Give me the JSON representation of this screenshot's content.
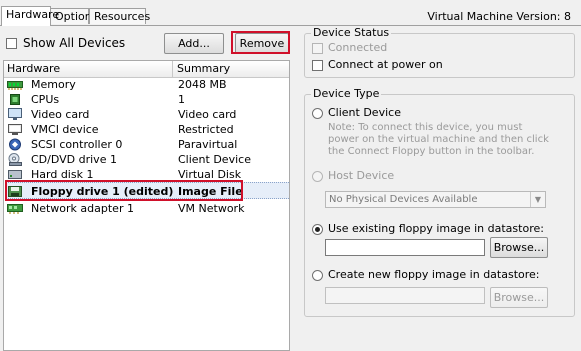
{
  "tabs": [
    {
      "label": "Hardware",
      "active": true
    },
    {
      "label": "Options",
      "active": false
    },
    {
      "label": "Resources",
      "active": false
    }
  ],
  "vm_version_label": "Virtual Machine Version: 8",
  "left": {
    "show_all_devices_label": "Show All Devices",
    "show_all_devices_checked": false,
    "add_button": "Add...",
    "remove_button": "Remove",
    "columns": [
      "Hardware",
      "Summary"
    ],
    "devices": [
      {
        "name": "Memory",
        "summary": "2048 MB",
        "icon": "memory-icon"
      },
      {
        "name": "CPUs",
        "summary": "1",
        "icon": "cpu-icon"
      },
      {
        "name": "Video card",
        "summary": "Video card",
        "icon": "monitor-icon"
      },
      {
        "name": "VMCI device",
        "summary": "Restricted",
        "icon": "vmci-icon"
      },
      {
        "name": "SCSI controller 0",
        "summary": "Paravirtual",
        "icon": "scsi-icon"
      },
      {
        "name": "CD/DVD drive 1",
        "summary": "Client Device",
        "icon": "cd-drive-icon"
      },
      {
        "name": "Hard disk 1",
        "summary": "Virtual Disk",
        "icon": "hard-disk-icon"
      },
      {
        "name": "Floppy drive 1 (edited)",
        "summary": "Image File",
        "icon": "floppy-drive-icon",
        "selected": true
      },
      {
        "name": "Network adapter 1",
        "summary": "VM Network",
        "icon": "network-adapter-icon"
      }
    ]
  },
  "device_status": {
    "title": "Device Status",
    "connected_label": "Connected",
    "connected_checked": false,
    "connect_at_power_on_label": "Connect at power on",
    "connect_at_power_on_checked": false
  },
  "device_type": {
    "title": "Device Type",
    "client_device_label": "Client Device",
    "client_device_note": "Note: To connect this device, you must power on the virtual machine and then click the Connect Floppy button in the toolbar.",
    "host_device_label": "Host Device",
    "host_device_select": "No Physical Devices Available",
    "use_existing_label": "Use existing floppy image in datastore:",
    "use_existing_value": "",
    "browse_label": "Browse...",
    "create_new_label": "Create new floppy image in datastore:",
    "create_new_value": "",
    "browse_disabled_label": "Browse...",
    "selected_option": "use_existing"
  }
}
